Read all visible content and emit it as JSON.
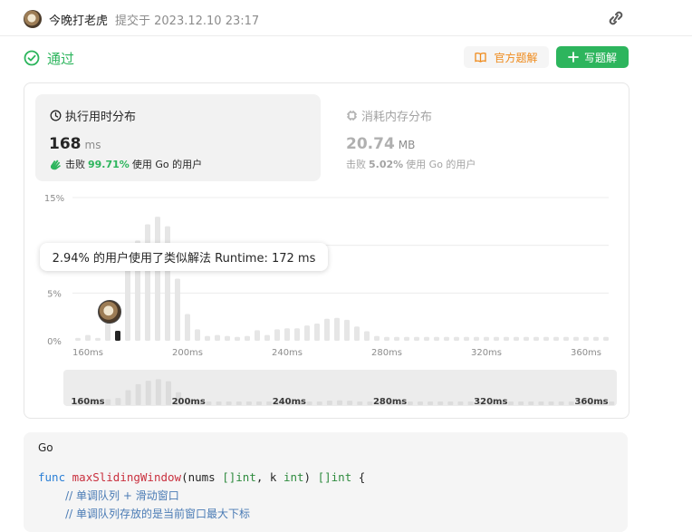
{
  "header": {
    "username": "今晚打老虎",
    "submitted": "提交于 2023.12.10 23:17"
  },
  "status": {
    "label": "通过",
    "official_solution": "官方题解",
    "write_solution": "写题解"
  },
  "runtime": {
    "title": "执行用时分布",
    "value": "168",
    "unit": "ms",
    "beats_prefix": "击败",
    "beats_pct": "99.71%",
    "beats_suffix": "使用 Go 的用户"
  },
  "memory": {
    "title": "消耗内存分布",
    "value": "20.74",
    "unit": "MB",
    "beats_prefix": "击败",
    "beats_pct": "5.02%",
    "beats_suffix": "使用 Go 的用户"
  },
  "tooltip": "2.94% 的用户使用了类似解法 Runtime: 172 ms",
  "colors": {
    "accent_green": "#2db55d",
    "orange": "#ef8a1b",
    "bar": "#e6e6e6",
    "bar_selected": "#262626"
  },
  "chart_data": {
    "type": "bar",
    "y_ticks": [
      "15%",
      "5%",
      "0%"
    ],
    "x_ticks": [
      "160ms",
      "200ms",
      "240ms",
      "280ms",
      "320ms",
      "360ms"
    ],
    "xlim": [
      156,
      371
    ],
    "ylim": [
      0,
      15
    ],
    "x_step": 4,
    "values": [
      0.3,
      0.6,
      0.3,
      2.94,
      3.6,
      7.5,
      10.5,
      12.2,
      13.0,
      12.0,
      6.5,
      2.8,
      1.2,
      0.5,
      0.6,
      0.5,
      0.4,
      0.5,
      1.1,
      0.6,
      1.2,
      1.3,
      1.3,
      1.6,
      1.8,
      2.3,
      2.4,
      2.2,
      1.5,
      1.0,
      0.5,
      0.4,
      0.4,
      0.4,
      0.4,
      0.4,
      0.4,
      0.4,
      0.4,
      0.4,
      0.4,
      0.4,
      0.4,
      0.4,
      0.4,
      0.4,
      0.4,
      0.4,
      0.4,
      0.4,
      0.4,
      0.4,
      0.4,
      0.4
    ],
    "selected_x": 172
  },
  "code": {
    "language": "Go",
    "lines": {
      "l1": {
        "kw": "func",
        "fn": "maxSlidingWindow",
        "p1": "(nums ",
        "t1": "[]int",
        "p2": ", k ",
        "t2": "int",
        "p3": ") ",
        "t3": "[]int",
        "p4": " {"
      },
      "l2": "// 单调队列 + 滑动窗口",
      "l3": "// 单调队列存放的是当前窗口最大下标"
    }
  }
}
